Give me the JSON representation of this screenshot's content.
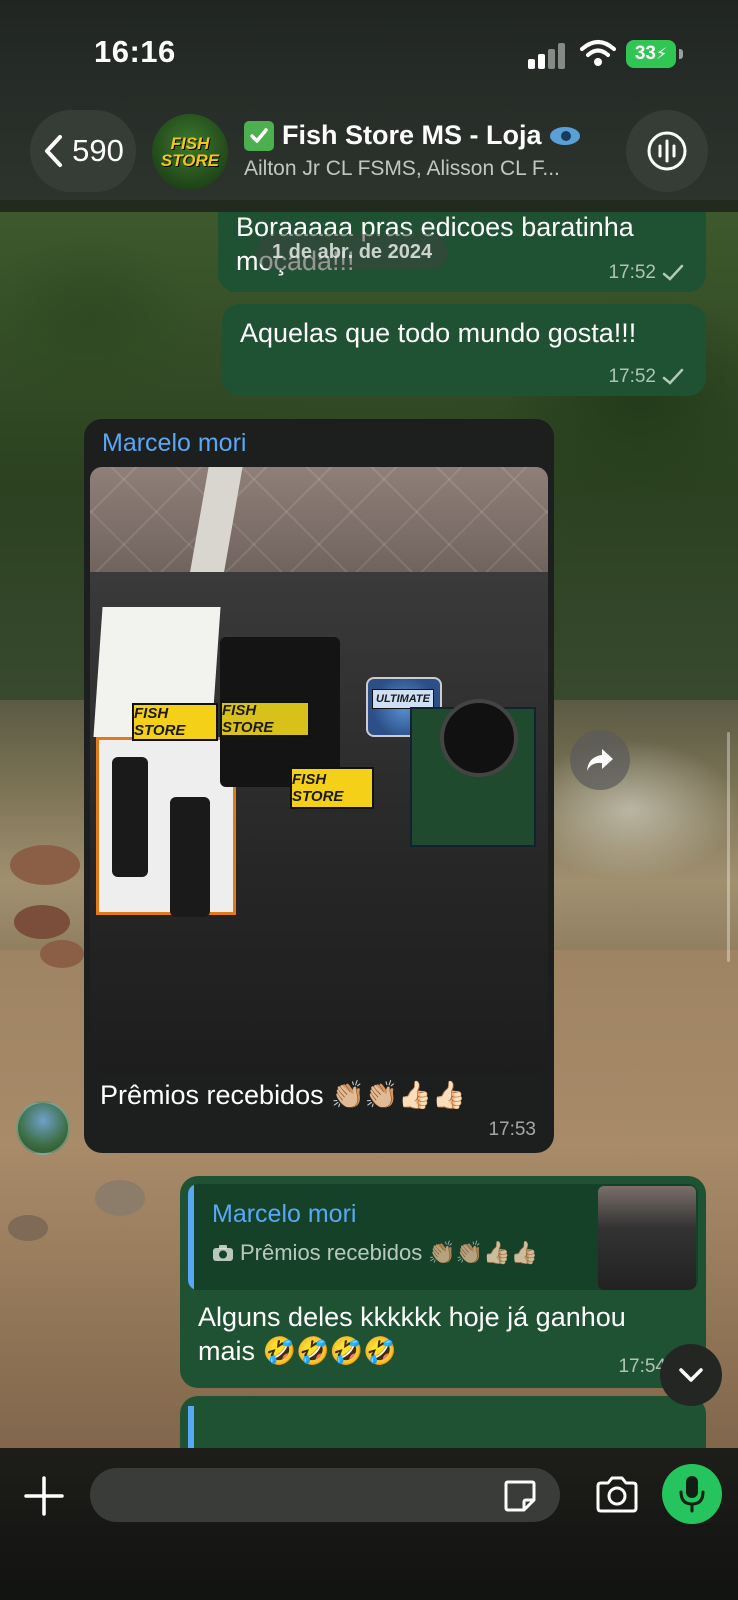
{
  "status_bar": {
    "time": "16:16",
    "battery": "33"
  },
  "header": {
    "back_count": "590",
    "group_name": "Fish Store MS - Loja",
    "members": "Ailton Jr CL FSMS, Alisson CL F...",
    "avatar_text": [
      "FISH",
      "STORE"
    ]
  },
  "chat": {
    "date_chip": "1 de abr. de 2024",
    "messages": [
      {
        "text": "Boraaaaa pras edicoes baratinha moçada!!!",
        "time": "17:52",
        "status": "sent-check"
      },
      {
        "text": "Aquelas que todo mundo gosta!!!",
        "time": "17:52",
        "status": "sent-check"
      }
    ],
    "incoming": {
      "sender": "Marcelo mori",
      "caption": "Prêmios recebidos 👏🏼👏🏼👍🏻👍🏻",
      "time": "17:53",
      "photo_labels": [
        "FISH STORE",
        "FISH STORE",
        "FISH STORE",
        "ULTIMATE"
      ]
    },
    "reply": {
      "quoted_sender": "Marcelo mori",
      "quoted_text": "Prêmios recebidos 👏🏼👏🏼👍🏻👍🏻",
      "text": "Alguns deles kkkkkk hoje já ganhou mais 🤣🤣🤣🤣",
      "time": "17:54"
    }
  },
  "input_bar": {
    "placeholder": ""
  },
  "colors": {
    "outgoing_bubble": "#1f5133",
    "incoming_bubble": "#1d1f1e",
    "sender_name": "#59a8f5",
    "mic_button": "#25c45e",
    "battery": "#31c653"
  },
  "icons": [
    "back-chevron-icon",
    "verified-check-icon",
    "eye-emoji-icon",
    "audio-call-icon",
    "share-forward-icon",
    "camera-small-icon",
    "chevron-down-icon",
    "plus-icon",
    "sticker-icon",
    "camera-icon",
    "microphone-icon"
  ]
}
